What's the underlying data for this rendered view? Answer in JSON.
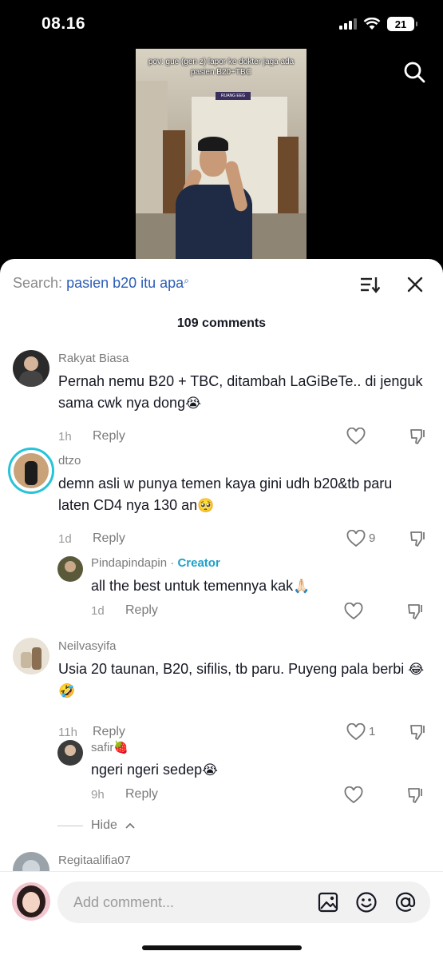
{
  "status_bar": {
    "time": "08.16",
    "battery": "21"
  },
  "video": {
    "caption": "pov: gue (gen z) lapor ke dokter jaga ada pasien B20+TBC",
    "sign_text": "RUANG EEG"
  },
  "header": {
    "search_prefix": "Search:",
    "search_query": "pasien b20 itu apa",
    "comments_count": "109 comments"
  },
  "comments": [
    {
      "user": "Rakyat Biasa",
      "text": "Pernah nemu B20 + TBC, ditambah LaGiBeTe.. di jenguk sama cwk nya dong",
      "emoji": "😭",
      "time": "1h",
      "reply": "Reply",
      "likes": ""
    },
    {
      "user": "dtzo",
      "text": "demn asli w punya temen kaya gini udh b20&tb paru laten CD4 nya 130 an",
      "emoji": "🥺",
      "time": "1d",
      "reply": "Reply",
      "likes": "9"
    },
    {
      "user": "Pindapindapin",
      "badge_sep": "·",
      "badge": "Creator",
      "text": "all the best untuk temennya kak",
      "emoji": "🙏🏻",
      "time": "1d",
      "reply": "Reply",
      "likes": ""
    },
    {
      "user": "Neilvasyifa",
      "text": "Usia 20 taunan, B20, sifilis, tb paru. Puyeng pala berbi",
      "emoji": "😂🤣",
      "time": "11h",
      "reply": "Reply",
      "likes": "1"
    },
    {
      "user": "safir",
      "user_emoji": "🍓",
      "text": "ngeri ngeri sedep",
      "emoji": "😭",
      "time": "9h",
      "reply": "Reply",
      "likes": ""
    },
    {
      "user": "Regitaalifia07"
    }
  ],
  "hide_label": "Hide",
  "input": {
    "placeholder": "Add comment..."
  },
  "icons": [
    "search-icon",
    "sort-icon",
    "close-icon",
    "heart-icon",
    "dislike-icon",
    "image-icon",
    "emoji-icon",
    "mention-icon"
  ],
  "colors": {
    "accent": "#2b5db7",
    "creator": "#1fa0c8",
    "text": "#161823",
    "muted": "#7a7a7a"
  }
}
